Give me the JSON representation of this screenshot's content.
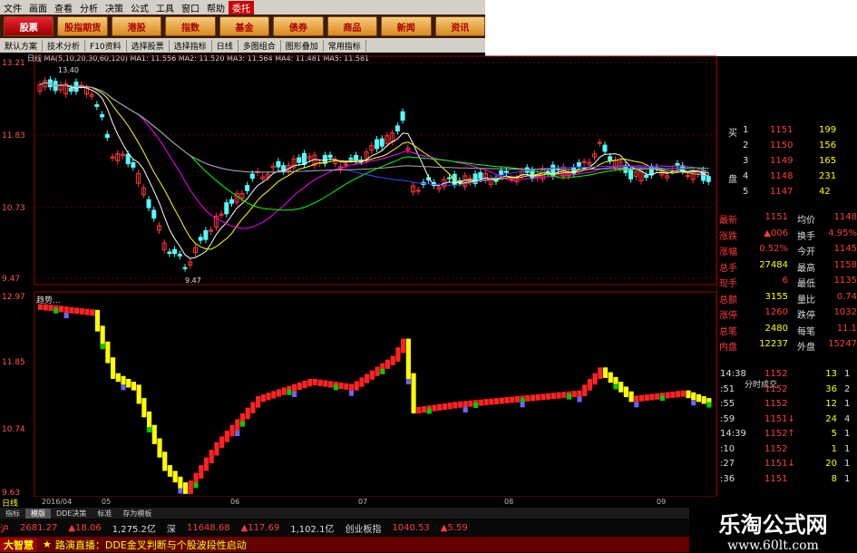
{
  "menu": [
    "文件",
    "画面",
    "查看",
    "分析",
    "决策",
    "公式",
    "工具",
    "窗口",
    "帮助",
    "委托"
  ],
  "top_buttons": [
    "股票",
    "股指期货",
    "港股",
    "指数",
    "基金",
    "债券",
    "商品",
    "新闻",
    "资讯"
  ],
  "toolbar2": [
    "默认方案",
    "技术分析",
    "F10资料",
    "选择股票",
    "选择指标",
    "日线",
    "多图组合",
    "图形叠加",
    "常用指标"
  ],
  "ma_label": "日线   MA(5,10,20,30,60,120)  MA1: 11.556  MA2: 11.520  MA3: 11.564  MA4: 11.481  MA5: 11.581",
  "upper_axis": [
    "13.21",
    "11.83",
    "10.73",
    "9.47"
  ],
  "high_mark": "13.40",
  "low_mark": "9.47",
  "lower_title": "趋势...",
  "lower_axis": [
    "12.97",
    "11.85",
    "10.74",
    "9.63"
  ],
  "dates": [
    "2016/04",
    "05",
    "06",
    "07",
    "08",
    "09"
  ],
  "period_label": "日线",
  "orderbook": [
    {
      "side": "买",
      "n": "1",
      "p": "1151",
      "v": "199"
    },
    {
      "side": "",
      "n": "2",
      "p": "1150",
      "v": "156"
    },
    {
      "side": "",
      "n": "3",
      "p": "1149",
      "v": "165"
    },
    {
      "side": "盘",
      "n": "4",
      "p": "1148",
      "v": "231"
    },
    {
      "side": "",
      "n": "5",
      "p": "1147",
      "v": "42"
    }
  ],
  "quote": [
    {
      "l": "最新",
      "v": "1151",
      "l2": "均价",
      "v2": "1148"
    },
    {
      "l": "涨跌",
      "v": "▲006",
      "l2": "换手",
      "v2": "4.95%"
    },
    {
      "l": "涨幅",
      "v": "0.52%",
      "l2": "今开",
      "v2": "1145"
    },
    {
      "l": "总手",
      "v": "27484",
      "l2": "最高",
      "v2": "1158"
    },
    {
      "l": "现手",
      "v": "6",
      "l2": "最低",
      "v2": "1135"
    },
    {
      "l": "总额",
      "v": "3155",
      "l2": "量比",
      "v2": "0.74"
    },
    {
      "l": "涨停",
      "v": "1260",
      "l2": "跌停",
      "v2": "1032"
    },
    {
      "l": "总笔",
      "v": "2480",
      "l2": "每笔",
      "v2": "11.1"
    },
    {
      "l": "内盘",
      "v": "12237",
      "l2": "外盘",
      "v2": "15247"
    }
  ],
  "trade_header": "分时成交",
  "trades": [
    {
      "t": "14:38",
      "p": "1152",
      "v": "13",
      "a": "1"
    },
    {
      "t": ":51",
      "p": "1152",
      "v": "36",
      "a": "2"
    },
    {
      "t": ":55",
      "p": "1152",
      "v": "12",
      "a": "1"
    },
    {
      "t": ":59",
      "p": "1151↓",
      "v": "24",
      "a": "4"
    },
    {
      "t": "14:39",
      "p": "1152↑",
      "v": "5",
      "a": "1"
    },
    {
      "t": ":10",
      "p": "1152",
      "v": "1",
      "a": "1"
    },
    {
      "t": ":27",
      "p": "1151↓",
      "v": "20",
      "a": "1"
    },
    {
      "t": ":36",
      "p": "1151",
      "v": "8",
      "a": "1"
    }
  ],
  "tabs": [
    "指标",
    "模版",
    "DDE决策",
    "标准",
    "存为模板"
  ],
  "index_bar": {
    "mkt": "沪",
    "v1": "2681.27",
    "c1": "▲18.06",
    "a1": "1,275.2亿",
    "mkt2": "深",
    "v2": "11648.68",
    "c2": "▲117.69",
    "a2": "1,102.1亿",
    "mkt3": "创业板指",
    "v3": "1040.53",
    "c3": "▲5.59"
  },
  "ticker": {
    "label": "大智慧",
    "text": "路演直播：DDE金叉判断与个股波段性启动"
  },
  "brand": {
    "name": "乐淘公式网",
    "url": "www.60lt.com"
  }
}
